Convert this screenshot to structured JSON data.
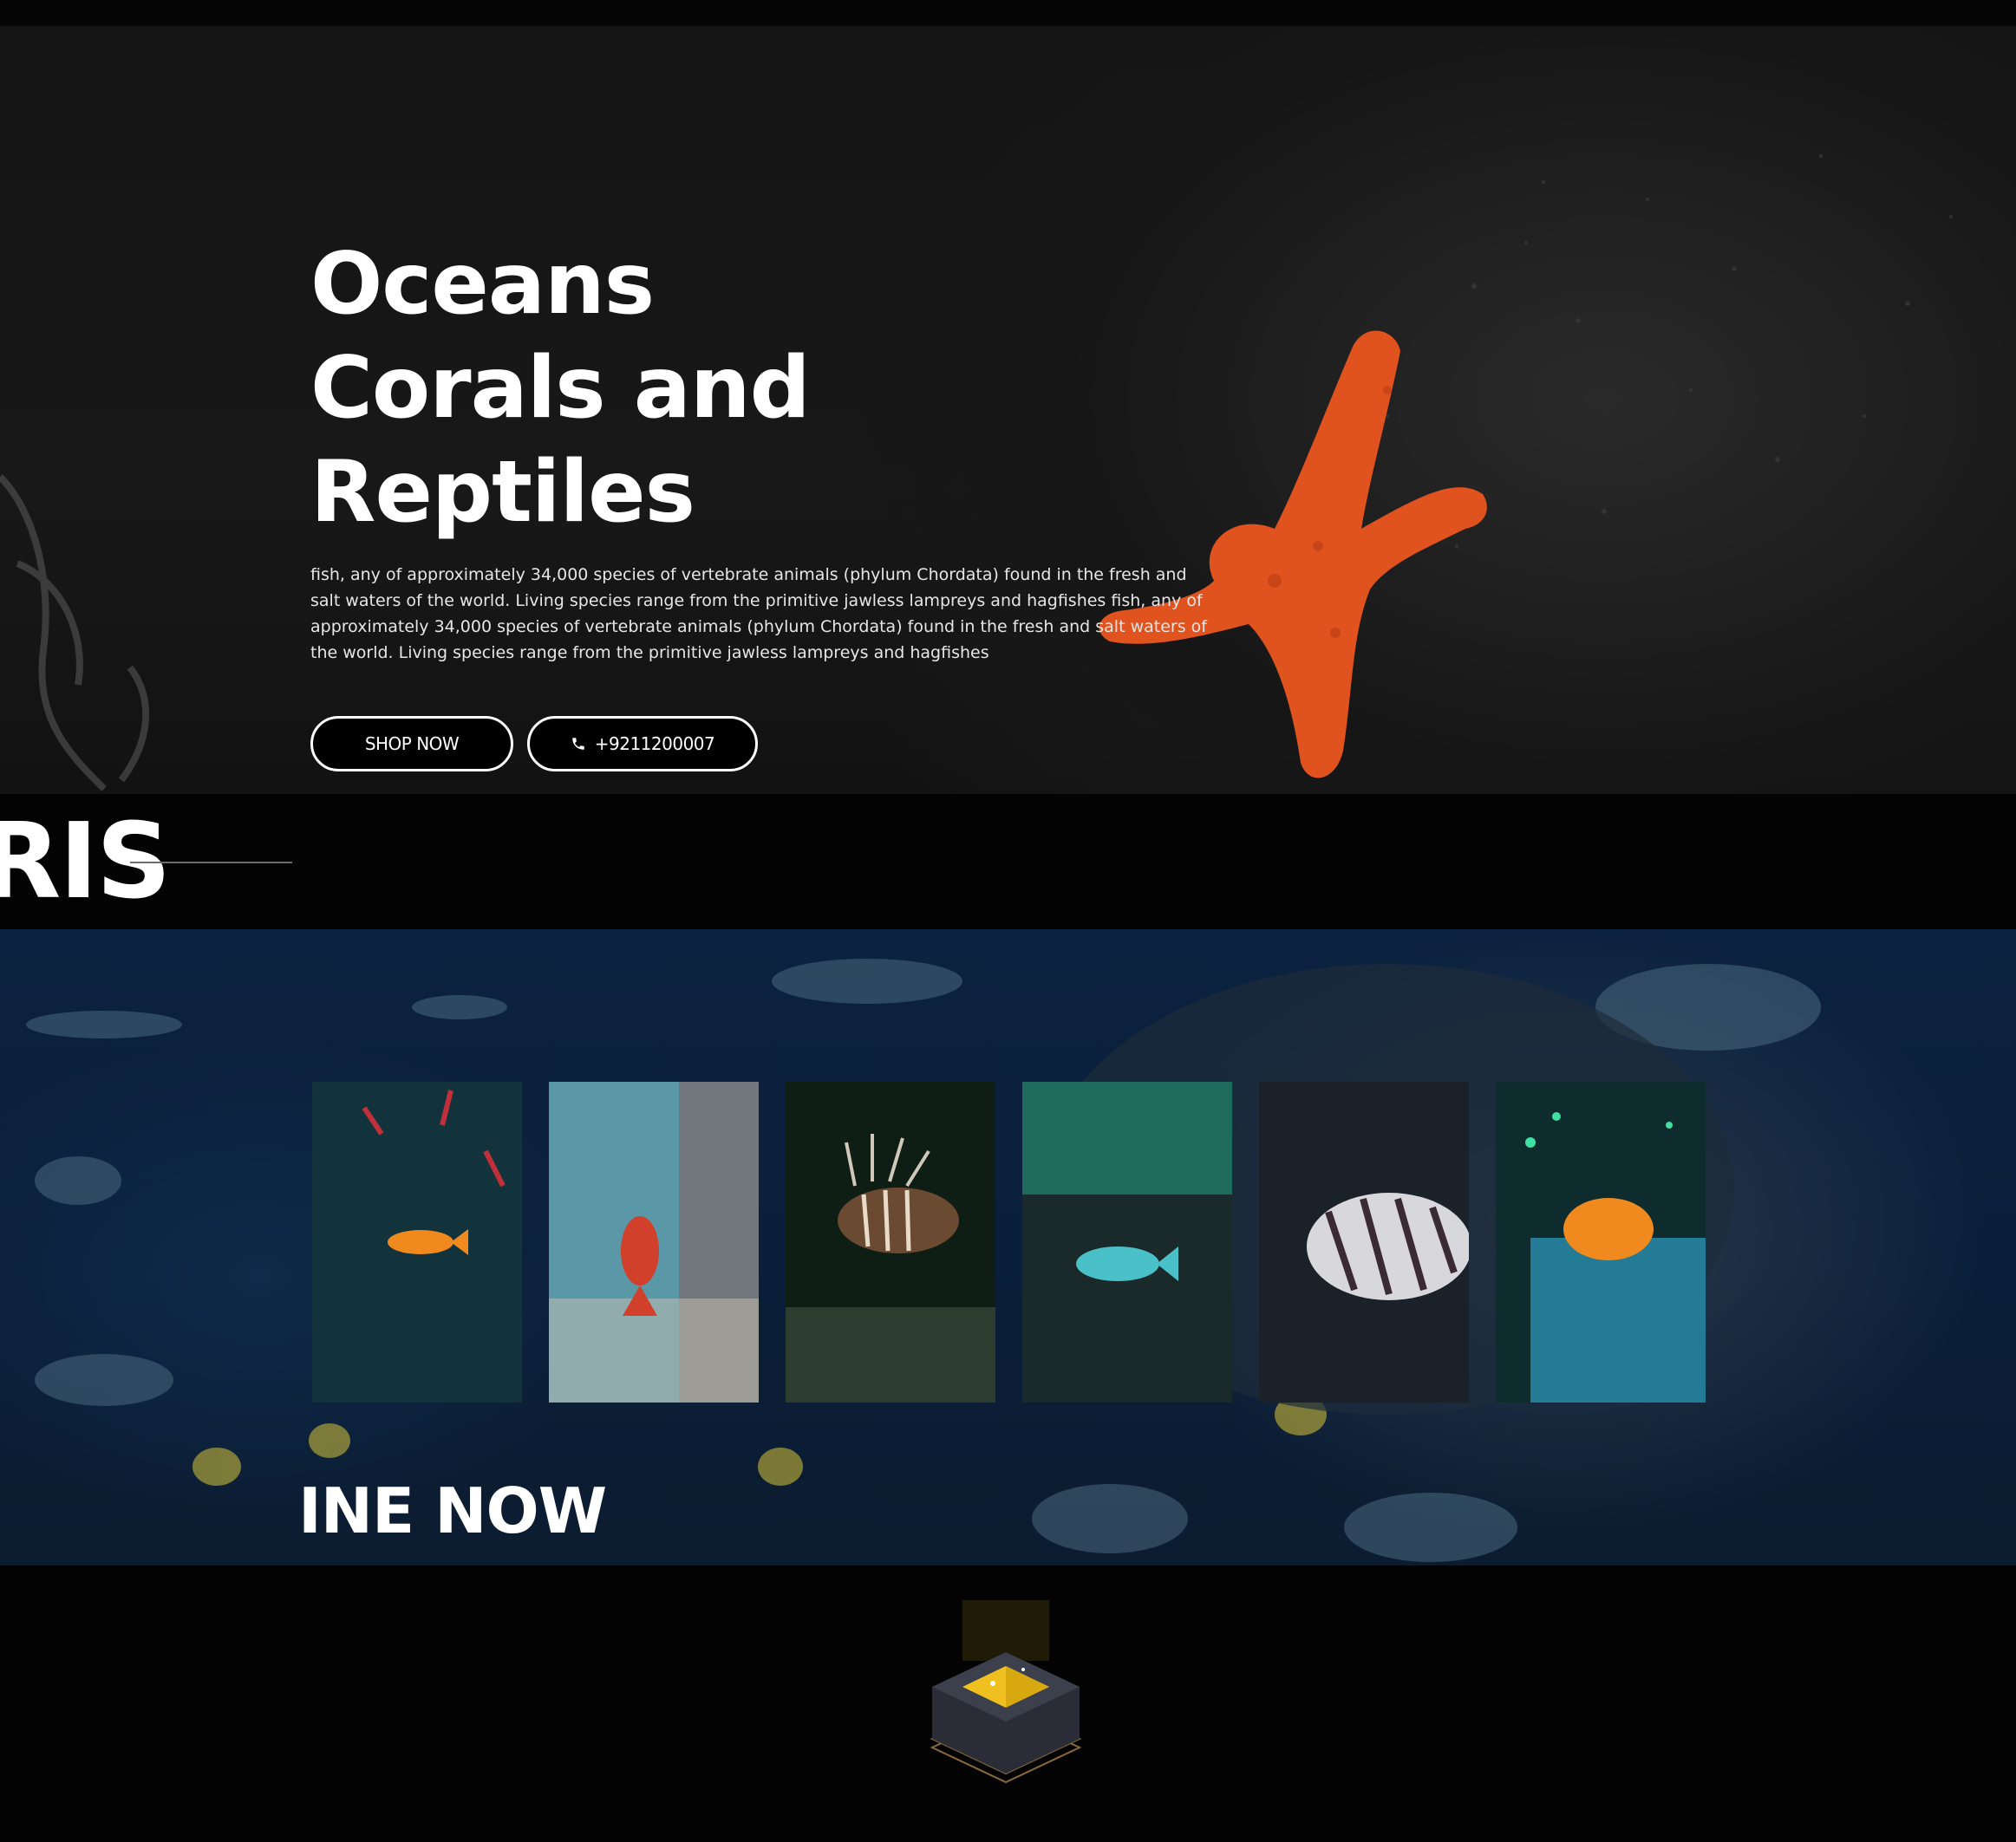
{
  "hero": {
    "title": "Oceans Corals and Reptiles",
    "description": "fish, any of approximately 34,000 species of vertebrate animals (phylum Chordata) found in the fresh and salt waters of the world. Living species range from the primitive jawless lampreys and hagfishes fish, any of approximately 34,000 species of vertebrate animals (phylum Chordata) found in the fresh and salt waters of the world. Living species range from the primitive jawless lampreys and hagfishes",
    "shop_button": "SHOP NOW",
    "phone_button": "+9211200007",
    "phone_icon": "phone-icon"
  },
  "section_heading": "RIS",
  "gallery": {
    "cards": [
      {
        "subject": "orange fish on dark teal coral"
      },
      {
        "subject": "red fish over sandy reef"
      },
      {
        "subject": "lionfish"
      },
      {
        "subject": "blue fish in green water"
      },
      {
        "subject": "striped lionfish close-up"
      },
      {
        "subject": "orange scorpionfish on coral"
      }
    ],
    "banner_text": "INE NOW"
  },
  "colors": {
    "background": "#030303",
    "starfish": "#e0521e",
    "ocean": "#0b2240",
    "logo_gold": "#f0c020"
  }
}
